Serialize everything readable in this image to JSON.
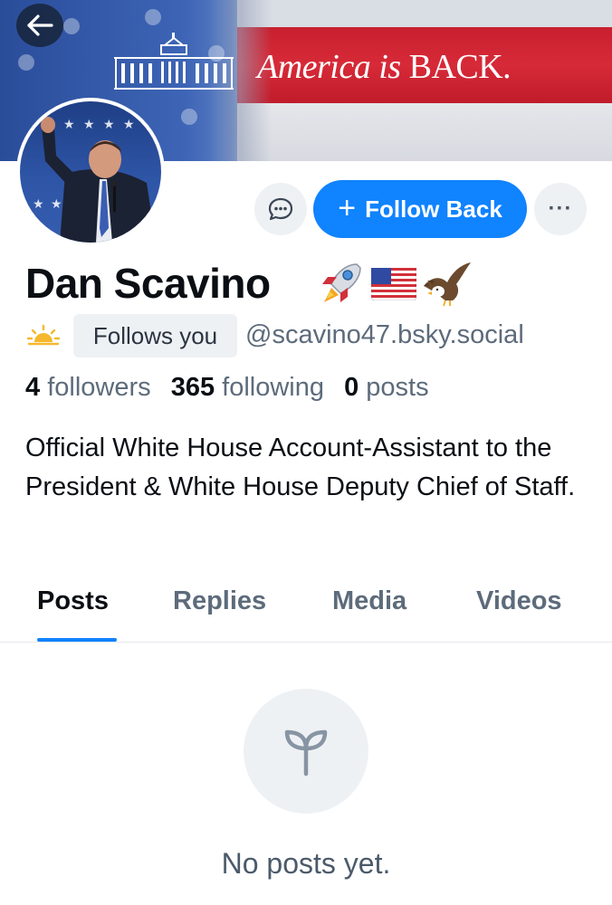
{
  "banner": {
    "text_part1": "America",
    "text_part2": "is",
    "text_part3": "BACK."
  },
  "icons": {
    "back": "arrow-left-icon",
    "message": "chat-bubble-icon",
    "more": "ellipsis-icon",
    "sun": "sunrise-icon",
    "empty": "seedling-icon"
  },
  "actions": {
    "follow_plus": "+",
    "follow_label": "Follow Back",
    "more_label": "···"
  },
  "profile": {
    "display_name": "Dan Scavino",
    "name_emojis": [
      "🚀",
      "🇺🇸",
      "🦅"
    ],
    "follows_you": "Follows you",
    "handle": "@scavino47.bsky.social",
    "followers_count": "4",
    "followers_label": "followers",
    "following_count": "365",
    "following_label": "following",
    "posts_count": "0",
    "posts_label": "posts",
    "bio": "Official White House Account-Assistant to the President & White House Deputy Chief of Staff."
  },
  "tabs": [
    {
      "label": "Posts",
      "active": true
    },
    {
      "label": "Replies",
      "active": false
    },
    {
      "label": "Media",
      "active": false
    },
    {
      "label": "Videos",
      "active": false
    }
  ],
  "empty_state": {
    "message": "No posts yet."
  },
  "colors": {
    "accent": "#1083fe",
    "muted_text": "#5d6b7b",
    "chip_bg": "#eef1f4"
  }
}
